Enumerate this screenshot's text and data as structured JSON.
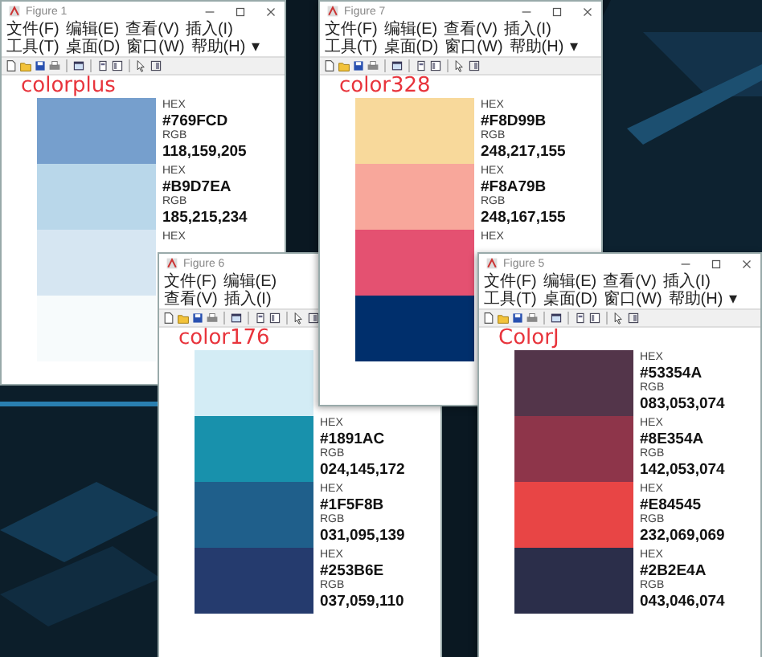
{
  "windows": [
    {
      "title": "Figure 1",
      "menu": [
        "文件(F)",
        "编辑(E)",
        "查看(V)",
        "插入(I)",
        "工具(T)",
        "桌面(D)",
        "窗口(W)",
        "帮助(H)"
      ],
      "menu_more": "▾",
      "palette_name": "colorplus",
      "swatches": [
        {
          "color": "#769fcd",
          "hex_label": "HEX",
          "hex": "#769FCD",
          "rgb_label": "RGB",
          "rgb": "118,159,205"
        },
        {
          "color": "#b9d7ea",
          "hex_label": "HEX",
          "hex": "#B9D7EA",
          "rgb_label": "RGB",
          "rgb": "185,215,234"
        },
        {
          "color": "#d6e6f2",
          "hex_label": "HEX"
        },
        {
          "color": "#f7fbfc"
        }
      ]
    },
    {
      "title": "Figure 7",
      "menu": [
        "文件(F)",
        "编辑(E)",
        "查看(V)",
        "插入(I)",
        "工具(T)",
        "桌面(D)",
        "窗口(W)",
        "帮助(H)"
      ],
      "menu_more": "▾",
      "palette_name": "color328",
      "swatches": [
        {
          "color": "#f8d99b",
          "hex_label": "HEX",
          "hex": "#F8D99B",
          "rgb_label": "RGB",
          "rgb": "248,217,155"
        },
        {
          "color": "#f8a79b",
          "hex_label": "HEX",
          "hex": "#F8A79B",
          "rgb_label": "RGB",
          "rgb": "248,167,155"
        },
        {
          "color": "#e45171",
          "hex_label": "HEX"
        },
        {
          "color": "#002f6c"
        }
      ]
    },
    {
      "title": "Figure 6",
      "menu": [
        "文件(F)",
        "编辑(E)",
        "查看(V)",
        "插入(I)"
      ],
      "palette_name": "color176",
      "swatches": [
        {
          "color": "#d3ecf5"
        },
        {
          "color": "#1891ac",
          "hex_label": "HEX",
          "hex": "#1891AC",
          "rgb_label": "RGB",
          "rgb": "024,145,172"
        },
        {
          "color": "#1f5f8b",
          "hex_label": "HEX",
          "hex": "#1F5F8B",
          "rgb_label": "RGB",
          "rgb": "031,095,139"
        },
        {
          "color": "#253b6e",
          "hex_label": "HEX",
          "hex": "#253B6E",
          "rgb_label": "RGB",
          "rgb": "037,059,110"
        }
      ]
    },
    {
      "title": "Figure 5",
      "menu": [
        "文件(F)",
        "编辑(E)",
        "查看(V)",
        "插入(I)",
        "工具(T)",
        "桌面(D)",
        "窗口(W)",
        "帮助(H)"
      ],
      "menu_more": "▾",
      "palette_name": "ColorJ",
      "swatches": [
        {
          "color": "#53354a",
          "hex_label": "HEX",
          "hex": "#53354A",
          "rgb_label": "RGB",
          "rgb": "083,053,074"
        },
        {
          "color": "#8e354a",
          "hex_label": "HEX",
          "hex": "#8E354A",
          "rgb_label": "RGB",
          "rgb": "142,053,074"
        },
        {
          "color": "#e84545",
          "hex_label": "HEX",
          "hex": "#E84545",
          "rgb_label": "RGB",
          "rgb": "232,069,069"
        },
        {
          "color": "#2b2e4a",
          "hex_label": "HEX",
          "hex": "#2B2E4A",
          "rgb_label": "RGB",
          "rgb": "043,046,074"
        }
      ]
    }
  ]
}
